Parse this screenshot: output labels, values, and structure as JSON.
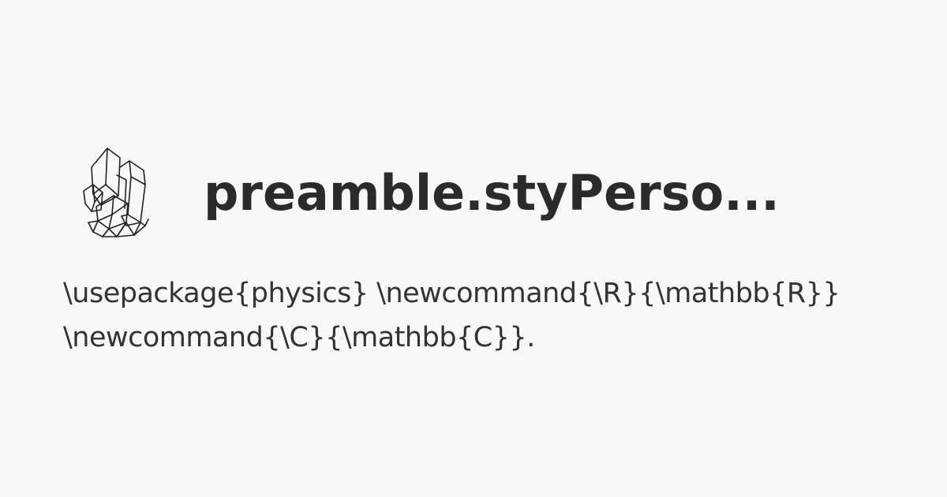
{
  "card": {
    "title": "preamble.styPerso...",
    "description": "\\usepackage{physics} \\newcommand{\\R}{\\mathbb{R}} \\newcommand{\\C}{\\mathbb{C}}.",
    "logo_icon": "crystal-cluster-icon",
    "colors": {
      "background": "#f9f8f9",
      "title": "#2b2b2b",
      "text": "#333333"
    }
  }
}
